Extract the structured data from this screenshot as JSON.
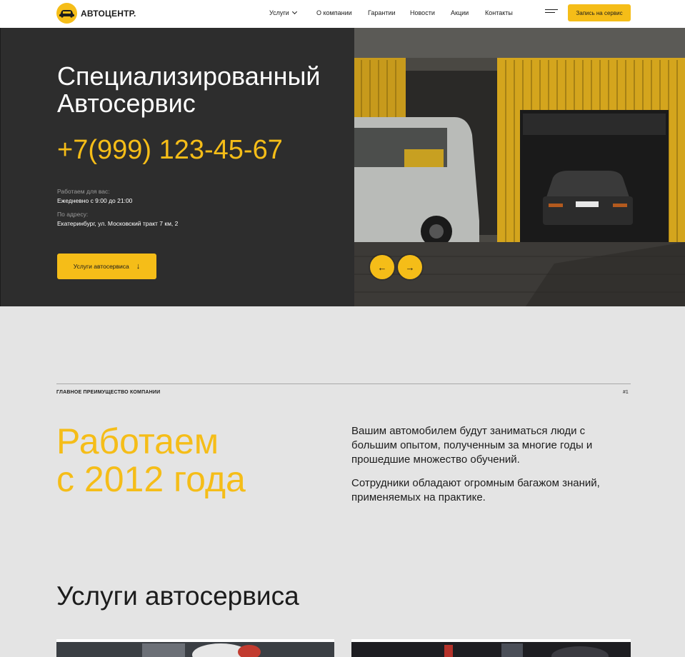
{
  "header": {
    "logo_text": "АВТОЦЕНТР.",
    "nav": [
      {
        "label": "Услуги",
        "has_dropdown": true
      },
      {
        "label": "О компании"
      },
      {
        "label": "Гарантии"
      },
      {
        "label": "Новости"
      },
      {
        "label": "Акции"
      },
      {
        "label": "Контакты"
      }
    ],
    "cta_label": "Запись на сервис"
  },
  "hero": {
    "title_line1": "Специализированный",
    "title_line2": "Автосервис",
    "phone": "+7(999) 123-45-67",
    "hours_label": "Работаем для вас:",
    "hours_value": "Ежедневно с 9:00 до 21:00",
    "address_label": "По адресу:",
    "address_value": "Екатеринбург, ул. Московский тракт 7 км, 2",
    "button_label": "Услуги автосервиса",
    "button_arrow": "↓",
    "prev_arrow": "←",
    "next_arrow": "→"
  },
  "advantage": {
    "label": "ГЛАВНОЕ ПРЕИМУЩЕСТВО КОМПАНИИ",
    "number": "#1",
    "big_line1": "Работаем",
    "big_line2": "с 2012 года",
    "para1": "Вашим автомобилем будут заниматься люди с большим опытом, полученным за многие годы и прошедшие множество обучений.",
    "para2": "Сотрудники обладают огромным багажом знаний, применяемых на практике."
  },
  "services": {
    "title": "Услуги автосервиса"
  },
  "colors": {
    "accent": "#f5bd18",
    "dark": "#2d2d2d",
    "page_bg": "#e4e4e4"
  }
}
